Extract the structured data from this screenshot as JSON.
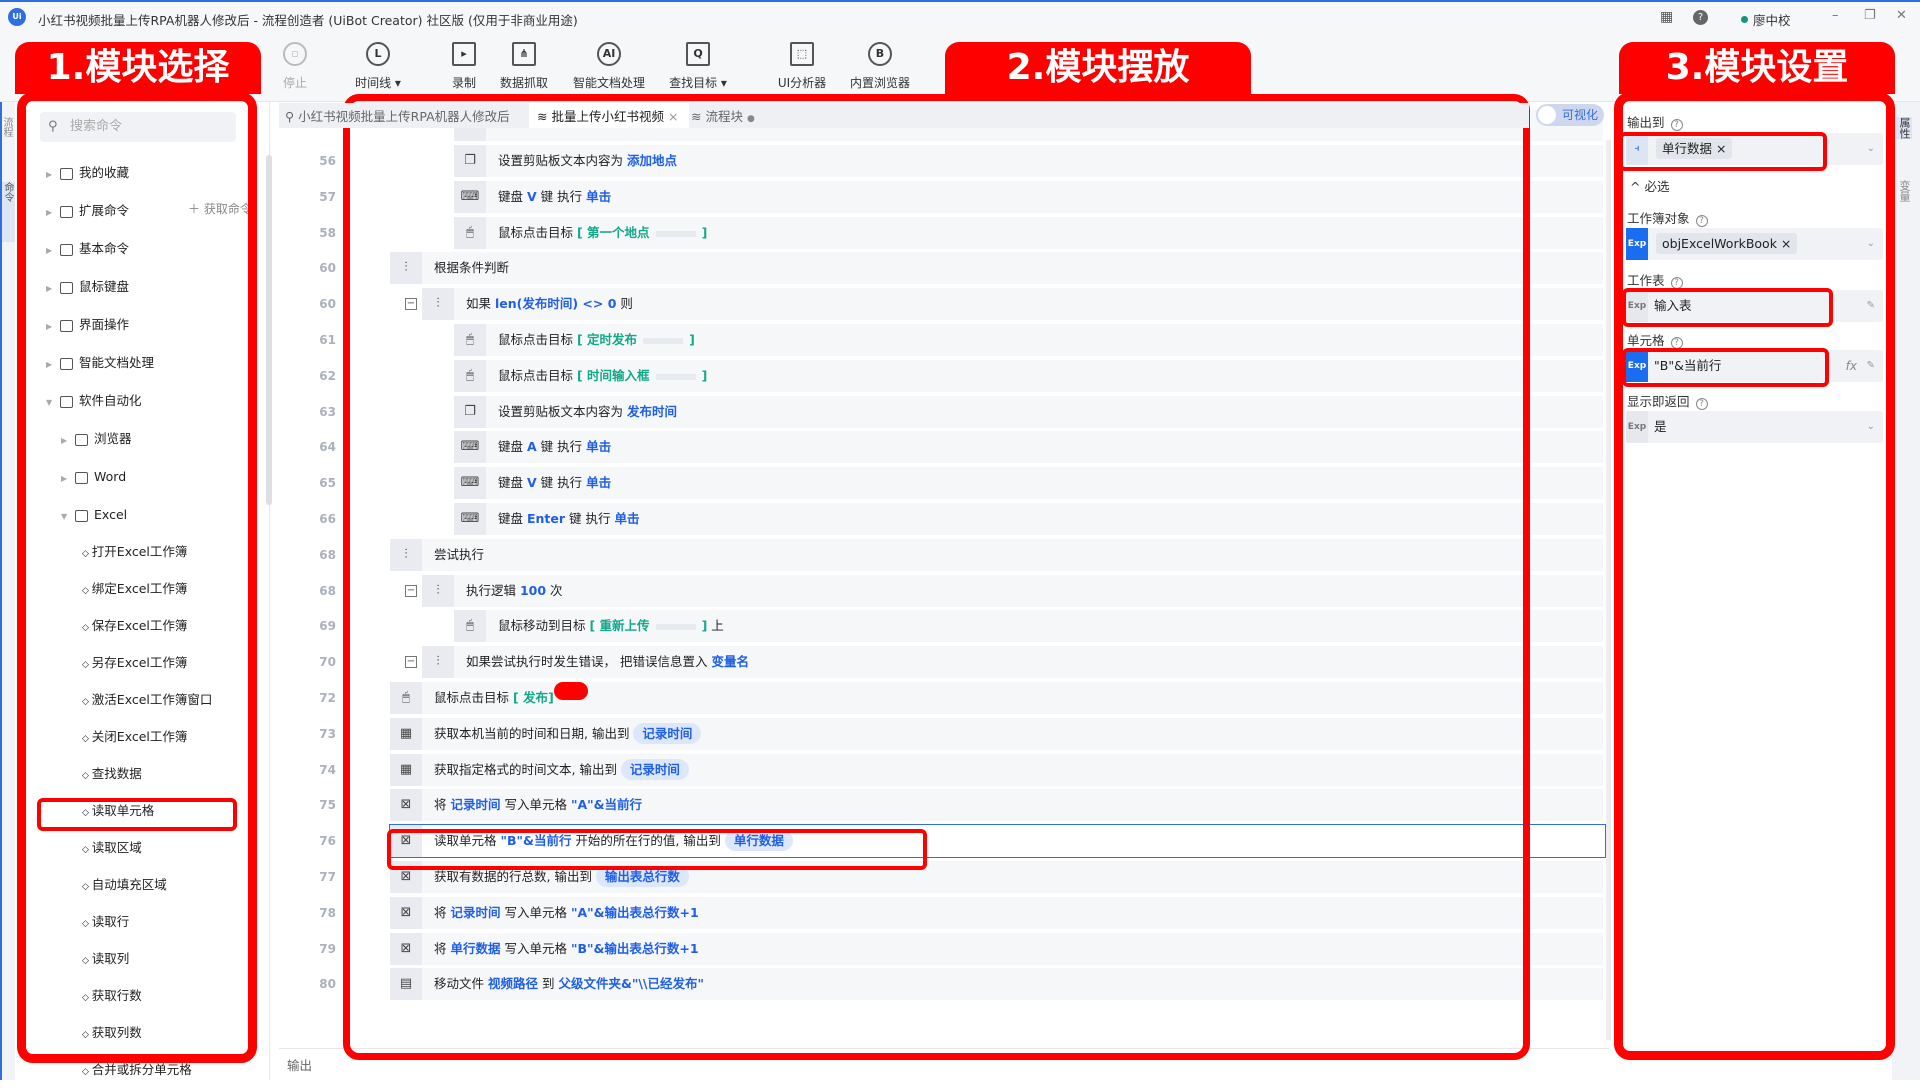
{
  "titlebar": {
    "title": "小红书视频批量上传RPA机器人修改后 - 流程创造者 (UiBot Creator) 社区版 (仅用于非商业用途)",
    "user": "廖中校"
  },
  "toolbar": [
    {
      "label": "停止",
      "icon": "stop-icon"
    },
    {
      "label": "时间线 ▾",
      "icon": "clock-icon"
    },
    {
      "label": "录制",
      "icon": "record-icon"
    },
    {
      "label": "数据抓取",
      "icon": "data-scrape-icon"
    },
    {
      "label": "智能文档处理",
      "icon": "ai-doc-icon"
    },
    {
      "label": "查找目标 ▾",
      "icon": "find-target-icon"
    },
    {
      "label": "UI分析器",
      "icon": "ui-analyzer-icon"
    },
    {
      "label": "内置浏览器",
      "icon": "browser-icon"
    }
  ],
  "sidebar": {
    "search_placeholder": "搜索命令",
    "get_command": "获取命令",
    "groups": [
      {
        "label": "我的收藏",
        "level": 0,
        "arrow": "▶"
      },
      {
        "label": "扩展命令",
        "level": 0,
        "arrow": "▶"
      },
      {
        "label": "基本命令",
        "level": 0,
        "arrow": "▶"
      },
      {
        "label": "鼠标键盘",
        "level": 0,
        "arrow": "▶"
      },
      {
        "label": "界面操作",
        "level": 0,
        "arrow": "▶"
      },
      {
        "label": "智能文档处理",
        "level": 0,
        "arrow": "▶"
      },
      {
        "label": "软件自动化",
        "level": 0,
        "arrow": "▼"
      },
      {
        "label": "浏览器",
        "level": 1,
        "arrow": "▶"
      },
      {
        "label": "Word",
        "level": 1,
        "arrow": "▶"
      },
      {
        "label": "Excel",
        "level": 1,
        "arrow": "▼"
      }
    ],
    "excel_items": [
      "打开Excel工作簿",
      "绑定Excel工作簿",
      "保存Excel工作簿",
      "另存Excel工作簿",
      "激活Excel工作簿窗口",
      "关闭Excel工作簿",
      "查找数据",
      "读取单元格",
      "读取区域",
      "自动填充区域",
      "读取行",
      "读取列",
      "获取行数",
      "获取列数",
      "合并或拆分单元格"
    ],
    "selected_item": "读取单元格"
  },
  "tabs": [
    {
      "label": "小红书视频批量上传RPA机器人修改后",
      "icon": "flow-icon"
    },
    {
      "label": "批量上传小红书视频",
      "icon": "layers-icon",
      "active": true,
      "close": "×"
    },
    {
      "label": "流程块",
      "icon": "layers-icon",
      "dot": "●"
    }
  ],
  "visualize_toggle": "可视化",
  "rows": [
    {
      "no": "56",
      "level": 3,
      "icon": "clipboard-icon",
      "glyph": "❐",
      "segs": [
        [
          "设置剪贴板文本内容为 ",
          ""
        ],
        [
          "添加地点",
          "var"
        ]
      ]
    },
    {
      "no": "57",
      "level": 3,
      "icon": "keyboard-icon",
      "glyph": "⌨",
      "segs": [
        [
          "键盘 ",
          ""
        ],
        [
          "V",
          "var"
        ],
        [
          " 键 执行 ",
          ""
        ],
        [
          "单击",
          "var"
        ]
      ]
    },
    {
      "no": "58",
      "level": 3,
      "icon": "mouse-icon",
      "glyph": "🖱",
      "segs": [
        [
          "鼠标点击目标 ",
          ""
        ],
        [
          "[ 第一个地点",
          "tgt"
        ],
        [
          "",
          "thumb"
        ],
        [
          "]",
          "tgt"
        ]
      ]
    },
    {
      "no": "60",
      "level": 1,
      "icon": "branch-icon",
      "glyph": "⫶",
      "segs": [
        [
          "根据条件判断",
          ""
        ]
      ]
    },
    {
      "no": "60",
      "level": 2,
      "icon": "branch-icon",
      "glyph": "⫶",
      "collapse": true,
      "segs": [
        [
          "如果 ",
          ""
        ],
        [
          "len(发布时间) <> 0",
          "var"
        ],
        [
          " 则",
          ""
        ]
      ]
    },
    {
      "no": "61",
      "level": 3,
      "icon": "mouse-icon",
      "glyph": "🖱",
      "segs": [
        [
          "鼠标点击目标 ",
          ""
        ],
        [
          "[ 定时发布",
          "tgt"
        ],
        [
          "",
          "thumb"
        ],
        [
          "]",
          "tgt"
        ]
      ]
    },
    {
      "no": "62",
      "level": 3,
      "icon": "mouse-icon",
      "glyph": "🖱",
      "segs": [
        [
          "鼠标点击目标 ",
          ""
        ],
        [
          "[ 时间输入框",
          "tgt"
        ],
        [
          "",
          "thumb"
        ],
        [
          "]",
          "tgt"
        ]
      ]
    },
    {
      "no": "63",
      "level": 3,
      "icon": "clipboard-icon",
      "glyph": "❐",
      "segs": [
        [
          "设置剪贴板文本内容为 ",
          ""
        ],
        [
          "发布时间",
          "var"
        ]
      ]
    },
    {
      "no": "64",
      "level": 3,
      "icon": "keyboard-icon",
      "glyph": "⌨",
      "segs": [
        [
          "键盘 ",
          ""
        ],
        [
          "A",
          "var"
        ],
        [
          " 键 执行 ",
          ""
        ],
        [
          "单击",
          "var"
        ]
      ]
    },
    {
      "no": "65",
      "level": 3,
      "icon": "keyboard-icon",
      "glyph": "⌨",
      "segs": [
        [
          "键盘 ",
          ""
        ],
        [
          "V",
          "var"
        ],
        [
          " 键 执行 ",
          ""
        ],
        [
          "单击",
          "var"
        ]
      ]
    },
    {
      "no": "66",
      "level": 3,
      "icon": "keyboard-icon",
      "glyph": "⌨",
      "segs": [
        [
          "键盘 ",
          ""
        ],
        [
          "Enter",
          "var"
        ],
        [
          " 键 执行 ",
          ""
        ],
        [
          "单击",
          "var"
        ]
      ]
    },
    {
      "no": "68",
      "level": 1,
      "icon": "branch-icon",
      "glyph": "⫶",
      "segs": [
        [
          "尝试执行",
          ""
        ]
      ]
    },
    {
      "no": "68",
      "level": 2,
      "icon": "branch-icon",
      "glyph": "⫶",
      "collapse": true,
      "segs": [
        [
          "执行逻辑 ",
          ""
        ],
        [
          "100",
          "var"
        ],
        [
          " 次",
          ""
        ]
      ]
    },
    {
      "no": "69",
      "level": 3,
      "icon": "mouse-icon",
      "glyph": "🖱",
      "segs": [
        [
          "鼠标移动到目标 ",
          ""
        ],
        [
          "[ 重新上传",
          "tgt"
        ],
        [
          "",
          "thumb"
        ],
        [
          "]",
          "tgt"
        ],
        [
          " 上",
          ""
        ]
      ]
    },
    {
      "no": "70",
      "level": 2,
      "icon": "branch-icon",
      "glyph": "⫶",
      "collapse": true,
      "segs": [
        [
          "如果尝试执行时发生错误， 把错误信息置入 ",
          ""
        ],
        [
          "变量名",
          "var"
        ]
      ]
    },
    {
      "no": "72",
      "level": 1,
      "icon": "mouse-icon",
      "glyph": "🖱",
      "segs": [
        [
          "鼠标点击目标 ",
          ""
        ],
        [
          "[ 发布",
          "tgt"
        ],
        [
          "",
          "thumbred"
        ],
        [
          "]",
          "tgt"
        ]
      ]
    },
    {
      "no": "73",
      "level": 1,
      "icon": "calendar-icon",
      "glyph": "▦",
      "segs": [
        [
          "获取本机当前的时间和日期, 输出到 ",
          ""
        ],
        [
          "记录时间",
          "chip"
        ]
      ]
    },
    {
      "no": "74",
      "level": 1,
      "icon": "calendar-icon",
      "glyph": "▦",
      "segs": [
        [
          "获取指定格式的时间文本, 输出到 ",
          ""
        ],
        [
          "记录时间",
          "chip"
        ]
      ]
    },
    {
      "no": "75",
      "level": 1,
      "icon": "excel-icon",
      "glyph": "⊠",
      "segs": [
        [
          "将 ",
          ""
        ],
        [
          "记录时间",
          "var"
        ],
        [
          " 写入单元格 ",
          ""
        ],
        [
          "\"A\"&当前行",
          "var"
        ]
      ]
    },
    {
      "no": "76",
      "level": 1,
      "icon": "excel-icon",
      "glyph": "⊠",
      "selected": true,
      "segs": [
        [
          "读取单元格 ",
          ""
        ],
        [
          "\"B\"&当前行",
          "var"
        ],
        [
          " 开始的所在行的值, 输出到 ",
          ""
        ],
        [
          "单行数据",
          "chip"
        ]
      ]
    },
    {
      "no": "77",
      "level": 1,
      "icon": "excel-icon",
      "glyph": "⊠",
      "segs": [
        [
          "获取有数据的行总数, 输出到 ",
          ""
        ],
        [
          "输出表总行数",
          "chip"
        ]
      ]
    },
    {
      "no": "78",
      "level": 1,
      "icon": "excel-icon",
      "glyph": "⊠",
      "segs": [
        [
          "将 ",
          ""
        ],
        [
          "记录时间",
          "var"
        ],
        [
          " 写入单元格 ",
          ""
        ],
        [
          "\"A\"&输出表总行数+1",
          "var"
        ]
      ]
    },
    {
      "no": "79",
      "level": 1,
      "icon": "excel-icon",
      "glyph": "⊠",
      "segs": [
        [
          "将 ",
          ""
        ],
        [
          "单行数据",
          "var"
        ],
        [
          " 写入单元格 ",
          ""
        ],
        [
          "\"B\"&输出表总行数+1",
          "var"
        ]
      ]
    },
    {
      "no": "80",
      "level": 1,
      "icon": "file-icon",
      "glyph": "▤",
      "segs": [
        [
          "移动文件 ",
          ""
        ],
        [
          "视频路径",
          "var"
        ],
        [
          " 到 ",
          ""
        ],
        [
          "父级文件夹&\"\\\\已经发布\"",
          "var"
        ]
      ]
    }
  ],
  "bottom": {
    "output_label": "输出"
  },
  "properties": {
    "output_to": {
      "label": "输出到",
      "value": "单行数据"
    },
    "required_section": "^ 必选",
    "workbook": {
      "label": "工作簿对象",
      "value": "objExcelWorkBook",
      "exp": "Exp"
    },
    "sheet": {
      "label": "工作表",
      "value": "输入表",
      "exp": "Exp"
    },
    "cell": {
      "label": "单元格",
      "value": "\"B\"&当前行",
      "exp": "Exp",
      "fx": "fx"
    },
    "show_return": {
      "label": "显示即返回",
      "value": "是",
      "exp": "Exp"
    }
  },
  "right_strip": {
    "tab1": "属性",
    "tab2": "变量"
  },
  "left_strip": {
    "tab1": "流程",
    "tab2": "命令"
  },
  "annotations": {
    "box1": "1.模块选择",
    "box2": "2.模块摆放",
    "box3": "3.模块设置",
    "color": "#ff0000"
  }
}
